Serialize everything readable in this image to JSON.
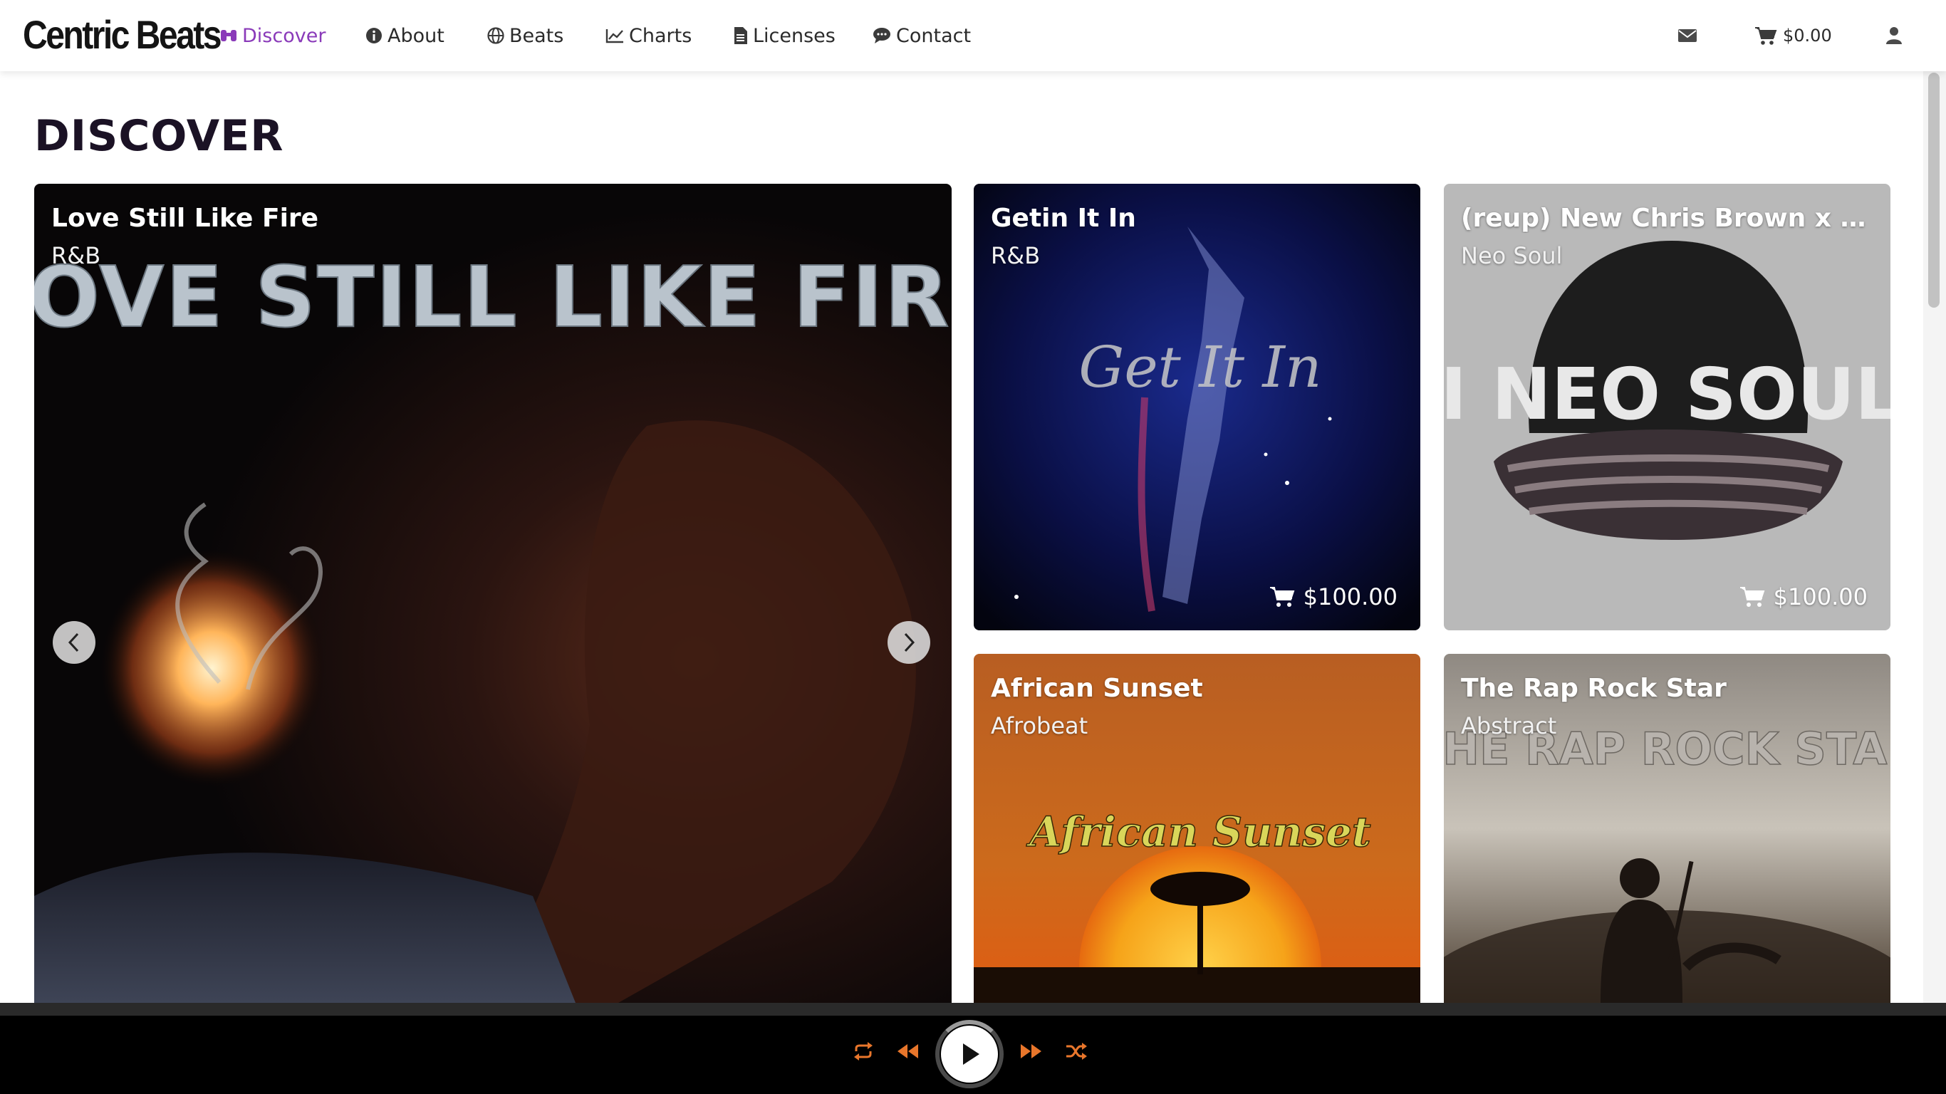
{
  "header": {
    "logo_text": "Centric Beats",
    "nav": [
      {
        "label": "Discover",
        "icon": "binoculars-icon",
        "active": true
      },
      {
        "label": "About",
        "icon": "info-circle-icon"
      },
      {
        "label": "Beats",
        "icon": "globe-icon"
      },
      {
        "label": "Charts",
        "icon": "line-chart-icon"
      },
      {
        "label": "Licenses",
        "icon": "document-icon"
      },
      {
        "label": "Contact",
        "icon": "comment-icon"
      }
    ],
    "cart_amount": "$0.00",
    "icons": [
      "envelope-icon",
      "cart-icon",
      "user-icon"
    ]
  },
  "page": {
    "title": "DISCOVER"
  },
  "featured": {
    "title": "Love Still Like Fire",
    "genre": "R&B",
    "artwork_text": "LOVE STILL LIKE FIRE"
  },
  "cards": [
    {
      "title": "Getin It In",
      "genre": "R&B",
      "price": "$100.00",
      "artwork_text": "Get It In"
    },
    {
      "title": "(reup) New Chris Brown x Sza ...",
      "genre": "Neo Soul",
      "price": "$100.00",
      "artwork_text": "I NEO SOUL"
    },
    {
      "title": "African Sunset",
      "genre": "Afrobeat",
      "artwork_text": "African Sunset"
    },
    {
      "title": "The Rap Rock Star",
      "genre": "Abstract",
      "artwork_text": "THE RAP ROCK STAR"
    }
  ],
  "player": {
    "controls": [
      "repeat-icon",
      "rewind-icon",
      "play-icon",
      "fast-forward-icon",
      "shuffle-icon"
    ],
    "accent_color": "#e8762b"
  },
  "colors": {
    "accent_purple": "#8a3ab9",
    "title_dark": "#1b1225",
    "player_bg": "#000000"
  }
}
